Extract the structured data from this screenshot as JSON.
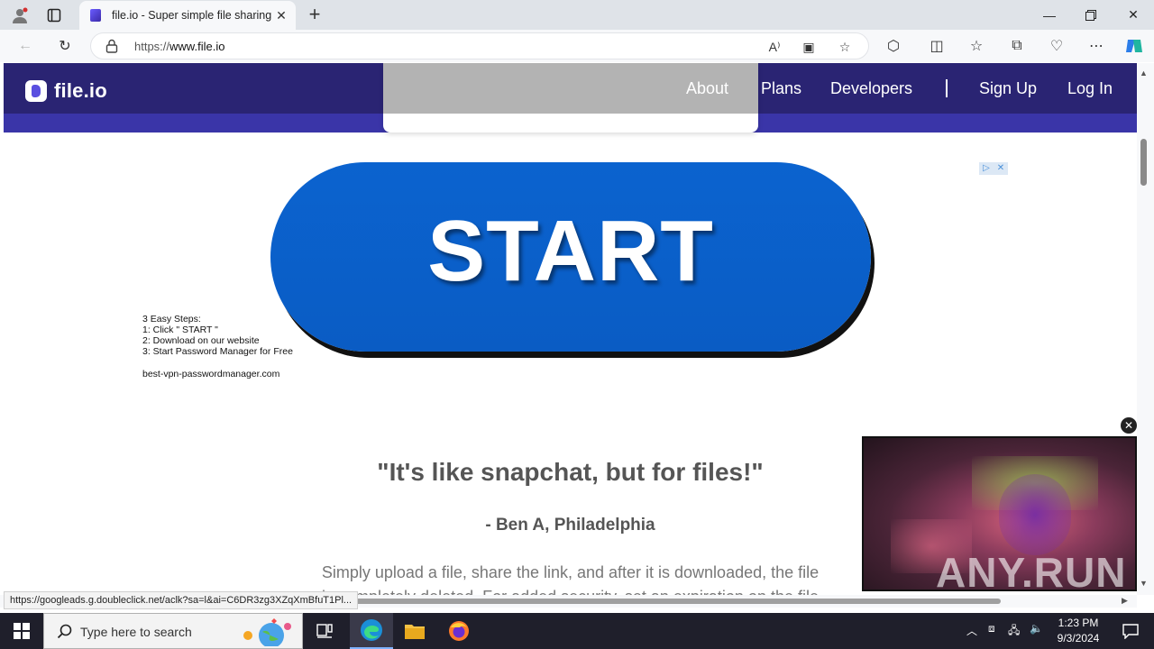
{
  "browser": {
    "tab_title": "file.io - Super simple file sharing",
    "url_prefix": "https://",
    "url_domain": "www.file.io",
    "status_url": "https://googleads.g.doubleclick.net/aclk?sa=l&ai=C6DR3zg3XZqXmBfuT1Pl..."
  },
  "site": {
    "logo_text": "file.io",
    "nav": {
      "about": "About",
      "plans": "Plans",
      "developers": "Developers",
      "sign_up": "Sign Up",
      "log_in": "Log In"
    },
    "colors": {
      "header": "#2a2473",
      "subbar": "#3a35a8",
      "ad_button": "#0b63cf"
    }
  },
  "ad": {
    "button_label": "START",
    "steps": [
      "3 Easy Steps:",
      "1: Click \" START \"",
      "2: Download on our website",
      "3: Start Password Manager for Free"
    ],
    "domain": "best-vpn-passwordmanager.com"
  },
  "testimonial": {
    "quote": "\"It's like snapchat, but for files!\"",
    "author": "- Ben A, Philadelphia",
    "desc_line1": "Simply upload a file, share the link, and after it is downloaded, the file",
    "desc_line2": "is completely deleted. For added security, set an expiration on the file"
  },
  "video_ad": {
    "watermark": "ANY.RUN"
  },
  "taskbar": {
    "search_placeholder": "Type here to search",
    "time": "1:23 PM",
    "date": "9/3/2024"
  }
}
